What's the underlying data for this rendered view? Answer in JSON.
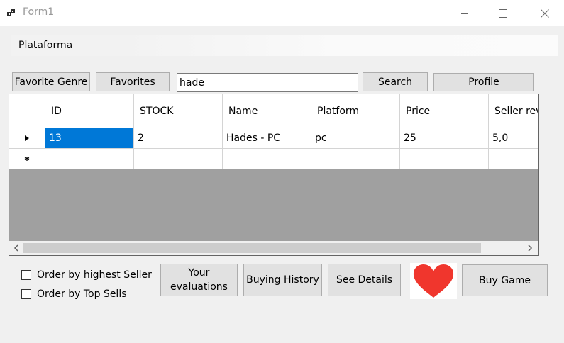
{
  "window": {
    "title": "Form1"
  },
  "menu": {
    "items": [
      "Plataforma"
    ]
  },
  "toolbar": {
    "favorite_genre": "Favorite Genre",
    "favorites": "Favorites",
    "search_value": "hade",
    "search": "Search",
    "profile": "Profile"
  },
  "grid": {
    "columns": [
      "ID",
      "STOCK",
      "Name",
      "Platform",
      "Price",
      "Seller rev"
    ],
    "rows": [
      [
        "13",
        "2",
        "Hades - PC",
        "pc",
        "25",
        "5,0"
      ]
    ]
  },
  "options": {
    "order_highest_seller": "Order by highest Seller",
    "order_top_sells": "Order by Top Sells"
  },
  "actions": {
    "your_evaluations_1": "Your",
    "your_evaluations_2": "evaluations",
    "buying_history": "Buying History",
    "see_details": "See Details",
    "buy_game": "Buy  Game"
  },
  "icons": {
    "favorite": "heart-icon",
    "heart_color": "#f0362d"
  }
}
